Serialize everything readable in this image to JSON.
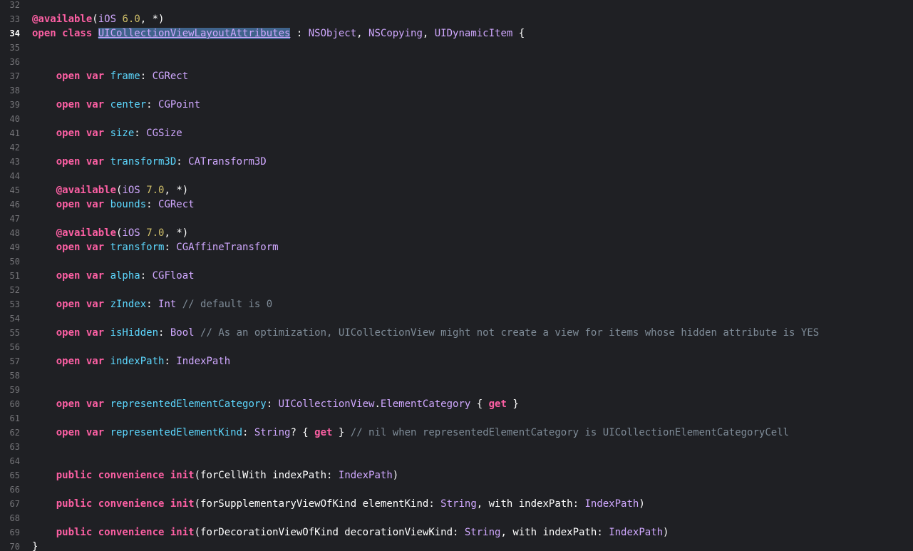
{
  "colors": {
    "background": "#1f2024",
    "keyword": "#fc5fa3",
    "number": "#d0bf69",
    "property": "#5dd8ff",
    "type": "#d0a8ff",
    "comment": "#7f8c98",
    "plain": "#ffffff",
    "line_number": "#747478",
    "selection": "#3f638b"
  },
  "current_line": "34",
  "lines": [
    {
      "n": "32",
      "tokens": []
    },
    {
      "n": "33",
      "tokens": [
        [
          "attr",
          "@available"
        ],
        [
          "plain",
          "("
        ],
        [
          "type",
          "iOS"
        ],
        [
          "plain",
          " "
        ],
        [
          "num",
          "6.0"
        ],
        [
          "plain",
          ", *)"
        ]
      ]
    },
    {
      "n": "34",
      "tokens": [
        [
          "kw",
          "open class "
        ],
        [
          "sel",
          "UICollectionViewLayoutAttributes"
        ],
        [
          "plain",
          " : "
        ],
        [
          "type",
          "NSObject"
        ],
        [
          "plain",
          ", "
        ],
        [
          "type",
          "NSCopying"
        ],
        [
          "plain",
          ", "
        ],
        [
          "type",
          "UIDynamicItem"
        ],
        [
          "plain",
          " {"
        ]
      ]
    },
    {
      "n": "35",
      "tokens": []
    },
    {
      "n": "36",
      "tokens": []
    },
    {
      "n": "37",
      "tokens": [
        [
          "plain",
          "    "
        ],
        [
          "kw",
          "open var "
        ],
        [
          "prop",
          "frame"
        ],
        [
          "plain",
          ": "
        ],
        [
          "type",
          "CGRect"
        ]
      ]
    },
    {
      "n": "38",
      "tokens": []
    },
    {
      "n": "39",
      "tokens": [
        [
          "plain",
          "    "
        ],
        [
          "kw",
          "open var "
        ],
        [
          "prop",
          "center"
        ],
        [
          "plain",
          ": "
        ],
        [
          "type",
          "CGPoint"
        ]
      ]
    },
    {
      "n": "40",
      "tokens": []
    },
    {
      "n": "41",
      "tokens": [
        [
          "plain",
          "    "
        ],
        [
          "kw",
          "open var "
        ],
        [
          "prop",
          "size"
        ],
        [
          "plain",
          ": "
        ],
        [
          "type",
          "CGSize"
        ]
      ]
    },
    {
      "n": "42",
      "tokens": []
    },
    {
      "n": "43",
      "tokens": [
        [
          "plain",
          "    "
        ],
        [
          "kw",
          "open var "
        ],
        [
          "prop",
          "transform3D"
        ],
        [
          "plain",
          ": "
        ],
        [
          "type",
          "CATransform3D"
        ]
      ]
    },
    {
      "n": "44",
      "tokens": []
    },
    {
      "n": "45",
      "tokens": [
        [
          "plain",
          "    "
        ],
        [
          "attr",
          "@available"
        ],
        [
          "plain",
          "("
        ],
        [
          "type",
          "iOS"
        ],
        [
          "plain",
          " "
        ],
        [
          "num",
          "7.0"
        ],
        [
          "plain",
          ", *)"
        ]
      ]
    },
    {
      "n": "46",
      "tokens": [
        [
          "plain",
          "    "
        ],
        [
          "kw",
          "open var "
        ],
        [
          "prop",
          "bounds"
        ],
        [
          "plain",
          ": "
        ],
        [
          "type",
          "CGRect"
        ]
      ]
    },
    {
      "n": "47",
      "tokens": []
    },
    {
      "n": "48",
      "tokens": [
        [
          "plain",
          "    "
        ],
        [
          "attr",
          "@available"
        ],
        [
          "plain",
          "("
        ],
        [
          "type",
          "iOS"
        ],
        [
          "plain",
          " "
        ],
        [
          "num",
          "7.0"
        ],
        [
          "plain",
          ", *)"
        ]
      ]
    },
    {
      "n": "49",
      "tokens": [
        [
          "plain",
          "    "
        ],
        [
          "kw",
          "open var "
        ],
        [
          "prop",
          "transform"
        ],
        [
          "plain",
          ": "
        ],
        [
          "type",
          "CGAffineTransform"
        ]
      ]
    },
    {
      "n": "50",
      "tokens": []
    },
    {
      "n": "51",
      "tokens": [
        [
          "plain",
          "    "
        ],
        [
          "kw",
          "open var "
        ],
        [
          "prop",
          "alpha"
        ],
        [
          "plain",
          ": "
        ],
        [
          "type",
          "CGFloat"
        ]
      ]
    },
    {
      "n": "52",
      "tokens": []
    },
    {
      "n": "53",
      "tokens": [
        [
          "plain",
          "    "
        ],
        [
          "kw",
          "open var "
        ],
        [
          "prop",
          "zIndex"
        ],
        [
          "plain",
          ": "
        ],
        [
          "type",
          "Int"
        ],
        [
          "plain",
          " "
        ],
        [
          "comment",
          "// default is 0"
        ]
      ]
    },
    {
      "n": "54",
      "tokens": []
    },
    {
      "n": "55",
      "tokens": [
        [
          "plain",
          "    "
        ],
        [
          "kw",
          "open var "
        ],
        [
          "prop",
          "isHidden"
        ],
        [
          "plain",
          ": "
        ],
        [
          "type",
          "Bool"
        ],
        [
          "plain",
          " "
        ],
        [
          "comment",
          "// As an optimization, UICollectionView might not create a view for items whose hidden attribute is YES"
        ]
      ]
    },
    {
      "n": "56",
      "tokens": []
    },
    {
      "n": "57",
      "tokens": [
        [
          "plain",
          "    "
        ],
        [
          "kw",
          "open var "
        ],
        [
          "prop",
          "indexPath"
        ],
        [
          "plain",
          ": "
        ],
        [
          "type",
          "IndexPath"
        ]
      ]
    },
    {
      "n": "58",
      "tokens": []
    },
    {
      "n": "59",
      "tokens": []
    },
    {
      "n": "60",
      "tokens": [
        [
          "plain",
          "    "
        ],
        [
          "kw",
          "open var "
        ],
        [
          "prop",
          "representedElementCategory"
        ],
        [
          "plain",
          ": "
        ],
        [
          "type",
          "UICollectionView"
        ],
        [
          "plain",
          "."
        ],
        [
          "type",
          "ElementCategory"
        ],
        [
          "plain",
          " { "
        ],
        [
          "kw",
          "get"
        ],
        [
          "plain",
          " }"
        ]
      ]
    },
    {
      "n": "61",
      "tokens": []
    },
    {
      "n": "62",
      "tokens": [
        [
          "plain",
          "    "
        ],
        [
          "kw",
          "open var "
        ],
        [
          "prop",
          "representedElementKind"
        ],
        [
          "plain",
          ": "
        ],
        [
          "type",
          "String"
        ],
        [
          "plain",
          "? { "
        ],
        [
          "kw",
          "get"
        ],
        [
          "plain",
          " } "
        ],
        [
          "comment",
          "// nil when representedElementCategory is UICollectionElementCategoryCell"
        ]
      ]
    },
    {
      "n": "63",
      "tokens": []
    },
    {
      "n": "64",
      "tokens": []
    },
    {
      "n": "65",
      "tokens": [
        [
          "plain",
          "    "
        ],
        [
          "kw",
          "public convenience init"
        ],
        [
          "plain",
          "(forCellWith indexPath: "
        ],
        [
          "type",
          "IndexPath"
        ],
        [
          "plain",
          ")"
        ]
      ]
    },
    {
      "n": "66",
      "tokens": []
    },
    {
      "n": "67",
      "tokens": [
        [
          "plain",
          "    "
        ],
        [
          "kw",
          "public convenience init"
        ],
        [
          "plain",
          "(forSupplementaryViewOfKind elementKind: "
        ],
        [
          "type",
          "String"
        ],
        [
          "plain",
          ", with indexPath: "
        ],
        [
          "type",
          "IndexPath"
        ],
        [
          "plain",
          ")"
        ]
      ]
    },
    {
      "n": "68",
      "tokens": []
    },
    {
      "n": "69",
      "tokens": [
        [
          "plain",
          "    "
        ],
        [
          "kw",
          "public convenience init"
        ],
        [
          "plain",
          "(forDecorationViewOfKind decorationViewKind: "
        ],
        [
          "type",
          "String"
        ],
        [
          "plain",
          ", with indexPath: "
        ],
        [
          "type",
          "IndexPath"
        ],
        [
          "plain",
          ")"
        ]
      ]
    },
    {
      "n": "70",
      "tokens": [
        [
          "plain",
          "}"
        ]
      ]
    }
  ]
}
